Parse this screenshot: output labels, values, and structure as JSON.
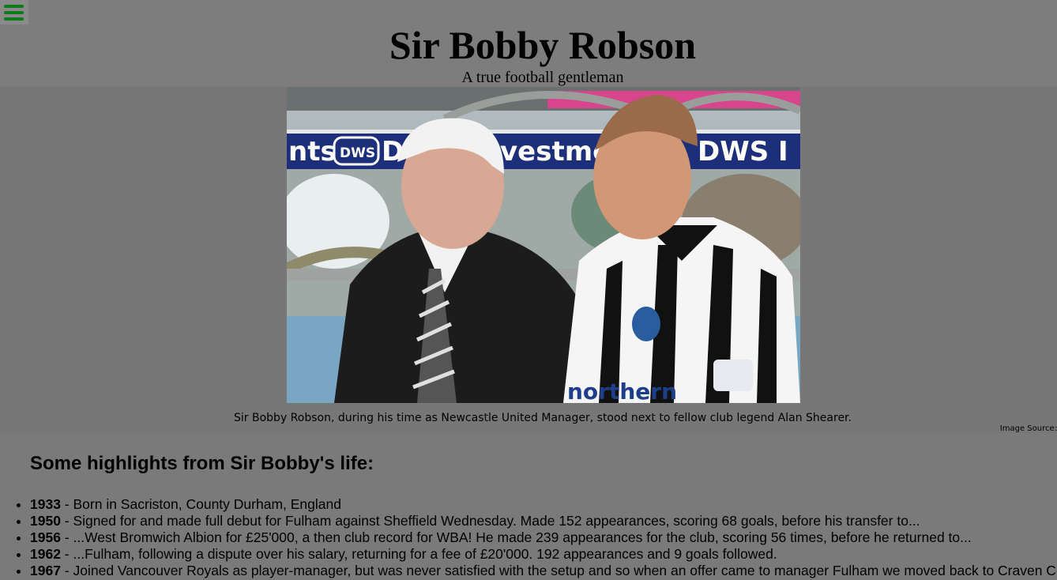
{
  "header": {
    "menu_icon": "hamburger-menu-icon",
    "accent_color": "#0d7a1c",
    "title": "Sir Bobby Robson",
    "subtitle": "A true football gentleman"
  },
  "figure": {
    "image_description_icon": "photo",
    "caption": "Sir Bobby Robson, during his time as Newcastle United Manager, stood next to fellow club legend Alan Shearer.",
    "source_label": "Image Source:",
    "banner_texts": [
      "nts",
      "DWS",
      "D",
      "vestme",
      "DWS I"
    ],
    "shirt_text": "northern"
  },
  "highlights": {
    "heading": "Some highlights from Sir Bobby's life:",
    "items": [
      {
        "year": "1933",
        "text": " - Born in Sacriston, County Durham, England"
      },
      {
        "year": "1950",
        "text": " - Signed for and made full debut for Fulham against Sheffield Wednesday. Made 152 appearances, scoring 68 goals, before his transfer to..."
      },
      {
        "year": "1956",
        "text": " - ...West Bromwich Albion for £25'000, a then club record for WBA! He made 239 appearances for the club, scoring 56 times, before he returned to..."
      },
      {
        "year": "1962",
        "text": " - ...Fulham, following a dispute over his salary, returning for a fee of £20'000. 192 appearances and 9 goals followed."
      },
      {
        "year": "1967",
        "text": " - Joined Vancouver Royals as player-manager, but was never satisfied with the setup and so when an offer came to manager Fulham we moved back to Craven Cottage"
      }
    ]
  }
}
